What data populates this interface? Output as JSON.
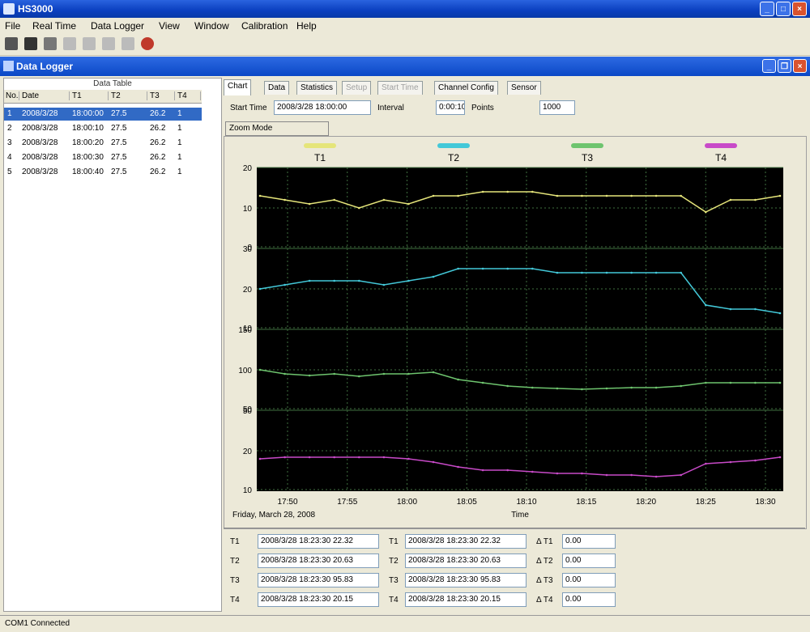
{
  "app": {
    "title": "HS3000"
  },
  "menu": [
    "File",
    "Real Time",
    "Data Logger",
    "View",
    "Window",
    "Calibration",
    "Help"
  ],
  "child_window": {
    "title": "Data Logger"
  },
  "data_table": {
    "title": "Data Table",
    "columns": [
      "No.",
      "Date",
      "T1",
      "T2",
      "T3",
      "T4"
    ],
    "rows": [
      [
        "1",
        "2008/3/28",
        "18:00:00",
        "27.5",
        "26.2",
        "1"
      ],
      [
        "2",
        "2008/3/28",
        "18:00:10",
        "27.5",
        "26.2",
        "1"
      ],
      [
        "3",
        "2008/3/28",
        "18:00:20",
        "27.5",
        "26.2",
        "1"
      ],
      [
        "4",
        "2008/3/28",
        "18:00:30",
        "27.5",
        "26.2",
        "1"
      ],
      [
        "5",
        "2008/3/28",
        "18:00:40",
        "27.5",
        "26.2",
        "1"
      ]
    ]
  },
  "tabs": [
    "Chart",
    "Data",
    "Statistics",
    "Setup",
    "Start Time",
    "Channel Config",
    "Sensor"
  ],
  "options": {
    "start_time_label": "Start Time",
    "start_time_value": "2008/3/28 18:00:00",
    "interval_label": "Interval",
    "interval_value": "0:00:10",
    "points_label": "Points",
    "points_value": "1000",
    "zoom_label": "Zoom Mode"
  },
  "chart_data": {
    "type": "line",
    "legend": [
      "T1",
      "T2",
      "T3",
      "T4"
    ],
    "colors": {
      "T1": "#e5e57a",
      "T2": "#43c8d8",
      "T3": "#6ec46e",
      "T4": "#c84ac8",
      "background": "#000000",
      "grid": "#3f6f3f"
    },
    "x_ticks": [
      "17:50",
      "17:55",
      "18:00",
      "18:05",
      "18:10",
      "18:15",
      "18:20",
      "18:25",
      "18:30"
    ],
    "x_label": "Time",
    "date_label": "Friday, March 28, 2008",
    "panels": [
      {
        "series": "T1",
        "y_ticks": [
          "20",
          "10",
          "0"
        ],
        "ylim": [
          0,
          20
        ],
        "values": [
          13,
          12,
          11,
          12,
          10,
          12,
          11,
          13,
          13,
          14,
          14,
          14,
          13,
          13,
          13,
          13,
          13,
          13,
          9,
          12,
          12,
          13
        ]
      },
      {
        "series": "T2",
        "y_ticks": [
          "30",
          "20",
          "10"
        ],
        "ylim": [
          10,
          30
        ],
        "values": [
          20,
          21,
          22,
          22,
          22,
          21,
          22,
          23,
          25,
          25,
          25,
          25,
          24,
          24,
          24,
          24,
          24,
          24,
          16,
          15,
          15,
          14
        ]
      },
      {
        "series": "T3",
        "y_ticks": [
          "150",
          "100",
          "50"
        ],
        "ylim": [
          50,
          150
        ],
        "values": [
          100,
          95,
          93,
          95,
          92,
          95,
          95,
          97,
          88,
          84,
          80,
          78,
          77,
          76,
          77,
          78,
          78,
          80,
          84,
          84,
          84,
          84
        ]
      },
      {
        "series": "T4",
        "y_ticks": [
          "50",
          "20",
          "10"
        ],
        "ylim": [
          0,
          50
        ],
        "values": [
          20,
          21,
          21,
          21,
          21,
          21,
          20,
          18,
          15,
          13,
          13,
          12,
          11,
          11,
          10,
          10,
          9,
          10,
          17,
          18,
          19,
          21
        ]
      }
    ]
  },
  "cursor_info": [
    {
      "label": "T1",
      "value": "2008/3/28 18:23:30 22.32"
    },
    {
      "label": "T2",
      "value": "2008/3/28 18:23:30 20.63"
    },
    {
      "label": "T3",
      "value": "2008/3/28 18:23:30 95.83"
    },
    {
      "label": "T4",
      "value": "2008/3/28 18:23:30 20.15"
    }
  ],
  "cursor_info_b": [
    {
      "label": "T1",
      "value": "2008/3/28 18:23:30 22.32"
    },
    {
      "label": "T2",
      "value": "2008/3/28 18:23:30 20.63"
    },
    {
      "label": "T3",
      "value": "2008/3/28 18:23:30 95.83"
    },
    {
      "label": "T4",
      "value": "2008/3/28 18:23:30 20.15"
    }
  ],
  "deltas": [
    {
      "label": "Δ T1",
      "value": "0.00"
    },
    {
      "label": "Δ T2",
      "value": "0.00"
    },
    {
      "label": "Δ T3",
      "value": "0.00"
    },
    {
      "label": "Δ T4",
      "value": "0.00"
    }
  ],
  "status": {
    "text": "COM1 Connected"
  }
}
